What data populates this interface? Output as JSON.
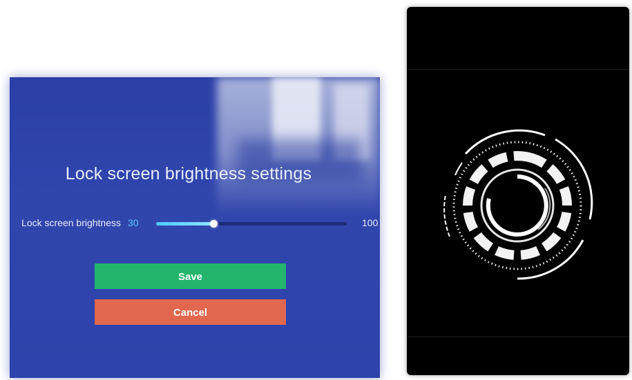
{
  "settings_dialog": {
    "title": "Lock screen brightness settings",
    "brightness_label": "Lock screen brightness",
    "brightness_value": "30",
    "brightness_max": "100",
    "brightness_fraction": 0.3,
    "save_label": "Save",
    "cancel_label": "Cancel"
  },
  "colors": {
    "panel_bg": "#2e43ab",
    "value_accent": "#58c2ff",
    "save_button": "#23b56c",
    "cancel_button": "#e1674e",
    "phone_bg": "#000000"
  },
  "phone": {
    "icon": "fingerprint-unlock-ring-icon"
  }
}
